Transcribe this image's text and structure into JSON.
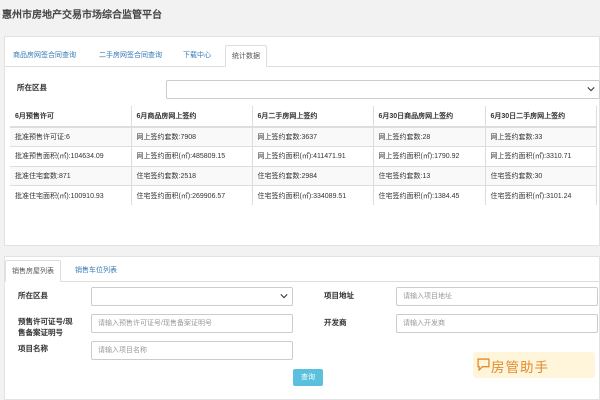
{
  "app": {
    "title": "惠州市房地产交易市场综合监管平台"
  },
  "tabs": [
    {
      "label": "商品房网签合同查询",
      "active": false
    },
    {
      "label": "二手房网签合同查询",
      "active": false
    },
    {
      "label": "下载中心",
      "active": false
    },
    {
      "label": "统计数据",
      "active": true
    }
  ],
  "stats_filter": {
    "district_label": "所在区县",
    "district_value": ""
  },
  "stats_table": {
    "headers": [
      "6月预售许可",
      "6月商品房网上签约",
      "6月二手房网上签约",
      "6月30日商品房网上签约",
      "6月30日二手房网上签约"
    ],
    "rows": [
      [
        "批准预售许可证:6",
        "网上签约套数:7908",
        "网上签约套数:3637",
        "网上签约套数:28",
        "网上签约套数:33"
      ],
      [
        "批准预售面积(㎡):104634.09",
        "网上签约面积(㎡):485809.15",
        "网上签约面积(㎡):411471.91",
        "网上签约面积(㎡):1790.92",
        "网上签约面积(㎡):3310.71"
      ],
      [
        "批准住宅套数:871",
        "住宅签约套数:2518",
        "住宅签约套数:2984",
        "住宅签约套数:13",
        "住宅签约套数:30"
      ],
      [
        "批准住宅面积(㎡):100910.93",
        "住宅签约面积(㎡):269906.57",
        "住宅签约面积(㎡):334089.51",
        "住宅签约面积(㎡):1384.45",
        "住宅签约面积(㎡):3101.24"
      ]
    ]
  },
  "sub_tabs": [
    {
      "label": "销售房屋列表",
      "active": true
    },
    {
      "label": "销售车位列表",
      "active": false
    }
  ],
  "search_form": {
    "district_label": "所在区县",
    "district_value": "",
    "address_label": "项目地址",
    "address_placeholder": "请输入项目地址",
    "permit_label_line1": "预售许可证号/现",
    "permit_label_line2": "售备案证明号",
    "permit_placeholder": "请输入预售许可证号/现售备案证明号",
    "developer_label": "开发商",
    "developer_placeholder": "请输入开发商",
    "project_label": "项目名称",
    "project_placeholder": "请输入项目名称",
    "query_button": "查询"
  },
  "watermark": {
    "text": "房管助手"
  },
  "colors": {
    "link": "#337ab7",
    "button": "#5bc0de",
    "watermark": "#e08a2d"
  }
}
